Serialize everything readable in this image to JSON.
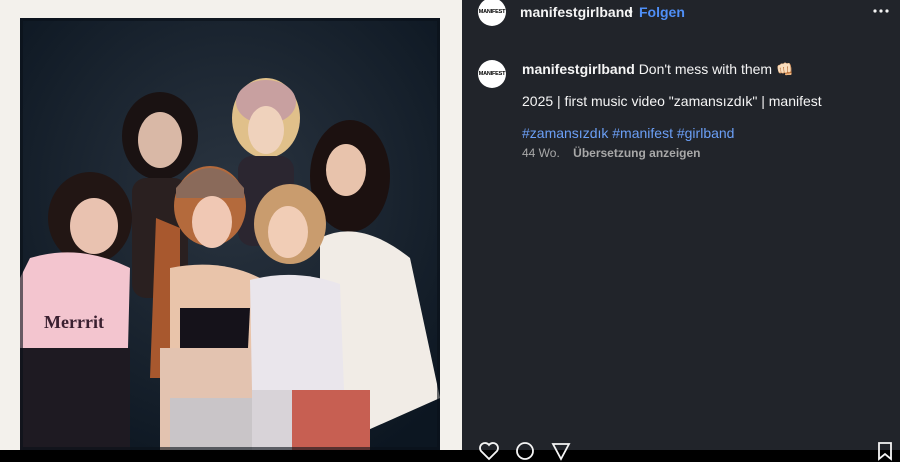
{
  "post": {
    "username": "manifestgirlband",
    "avatar_text": "MANIFEST",
    "separator": "•",
    "follow_label": "Folgen",
    "more_icon": "more-horizontal-icon"
  },
  "caption": {
    "username": "manifestgirlband",
    "text": "Don't mess with them 👊🏻",
    "line2": "2025 | first music video \"zamansızdık\" | manifest",
    "hashtags": [
      "#zamansızdık",
      "#manifest",
      "#girlband"
    ],
    "age": "44 Wo.",
    "translate_label": "Übersetzung anzeigen"
  },
  "actions": {
    "icons": [
      "heart-icon",
      "comment-icon",
      "share-icon",
      "bookmark-icon"
    ]
  },
  "colors": {
    "post_bg": "#21242a",
    "follow_blue": "#4f8ff7",
    "hashtag_blue": "#6b9ff6",
    "meta_gray": "#a8a8a8",
    "photo_bg": "#f3f1ec",
    "polaroid_bg": "#14202e"
  }
}
